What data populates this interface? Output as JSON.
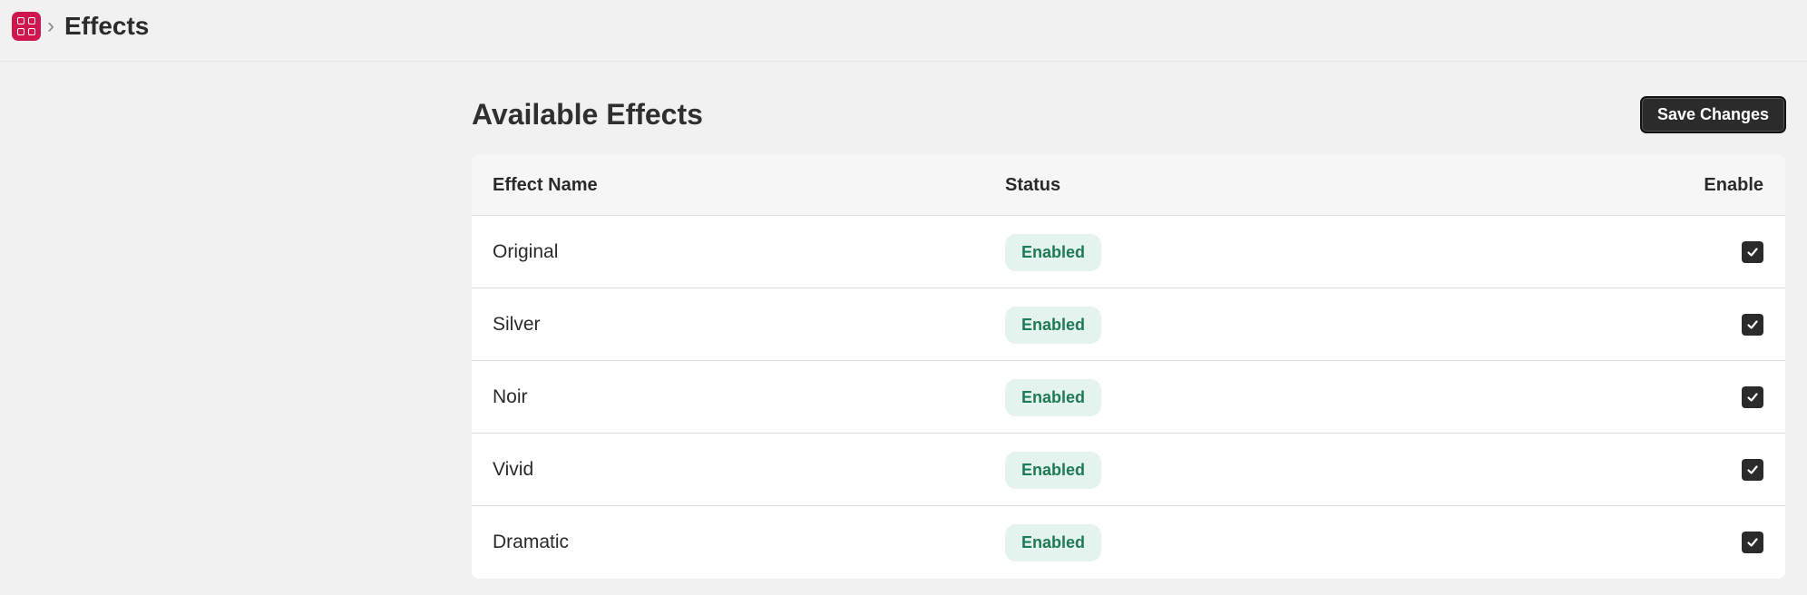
{
  "header": {
    "app_icon": "app-grid-icon",
    "separator": "›",
    "title": "Effects"
  },
  "main": {
    "heading": "Available Effects",
    "save_label": "Save Changes"
  },
  "table": {
    "columns": [
      "Effect Name",
      "Status",
      "Enable"
    ],
    "rows": [
      {
        "name": "Original",
        "status": "Enabled",
        "enabled": true
      },
      {
        "name": "Silver",
        "status": "Enabled",
        "enabled": true
      },
      {
        "name": "Noir",
        "status": "Enabled",
        "enabled": true
      },
      {
        "name": "Vivid",
        "status": "Enabled",
        "enabled": true
      },
      {
        "name": "Dramatic",
        "status": "Enabled",
        "enabled": true
      }
    ]
  },
  "colors": {
    "brand": "#d0164f",
    "badge_bg": "#e4f3ee",
    "badge_text": "#1e7a55",
    "button_bg": "#2b2b2b"
  }
}
